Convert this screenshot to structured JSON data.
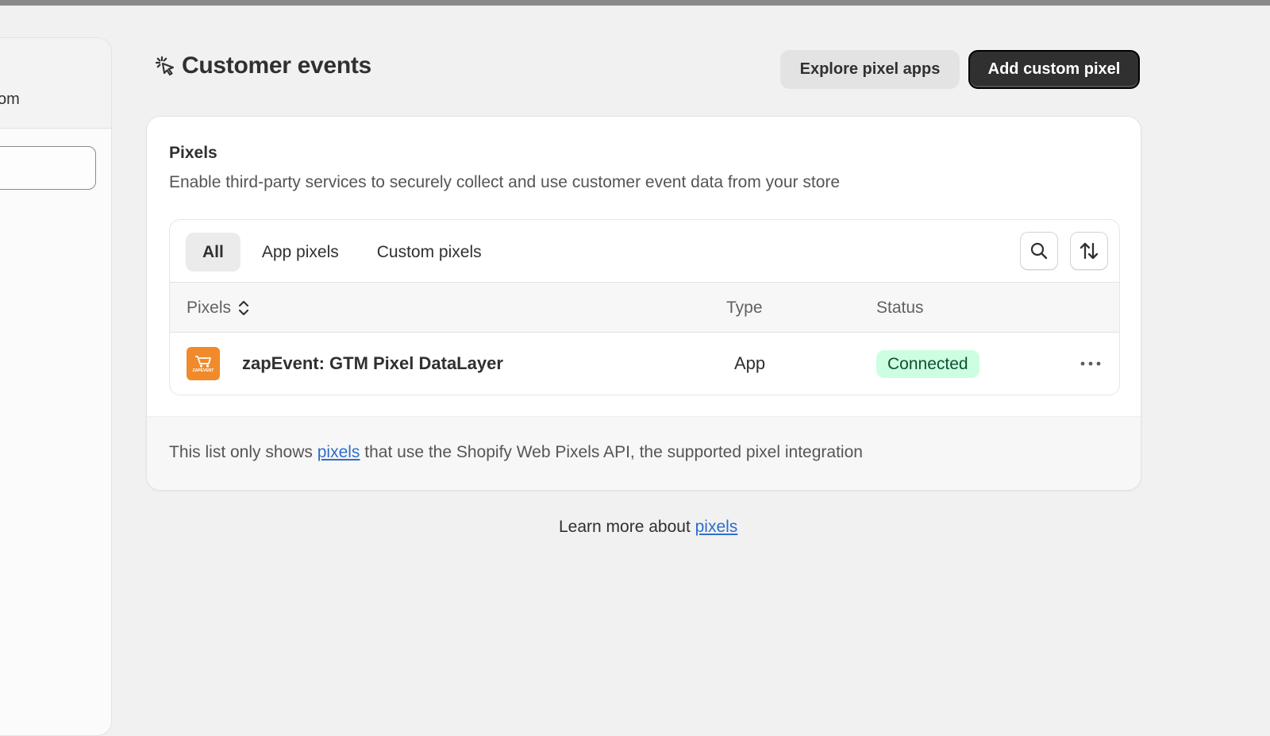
{
  "side_panel": {
    "header_text": "om",
    "search_value": ""
  },
  "header": {
    "title": "Customer events",
    "icon": "cursor-click-icon",
    "explore_label": "Explore pixel apps",
    "add_label": "Add custom pixel"
  },
  "card": {
    "title": "Pixels",
    "description": "Enable third-party services to securely collect and use customer event data from your store",
    "tabs": [
      {
        "label": "All",
        "active": true
      },
      {
        "label": "App pixels",
        "active": false
      },
      {
        "label": "Custom pixels",
        "active": false
      }
    ],
    "columns": {
      "pixels": "Pixels",
      "type": "Type",
      "status": "Status"
    },
    "rows": [
      {
        "name": "zapEvent: GTM Pixel DataLayer",
        "type": "App",
        "status": "Connected",
        "icon": "zapevent-app-icon",
        "icon_text": "ZAPEVENT"
      }
    ],
    "footer": {
      "before": "This list only shows ",
      "link": "pixels",
      "after": " that use the Shopify Web Pixels API, the supported pixel integration"
    }
  },
  "learn_more": {
    "text": "Learn more about ",
    "link": "pixels"
  },
  "colors": {
    "primary_button": "#303030",
    "badge_bg": "#cdfee1",
    "badge_text": "#0c5132",
    "link": "#2c6ecb",
    "app_icon": "#f08a2a"
  }
}
